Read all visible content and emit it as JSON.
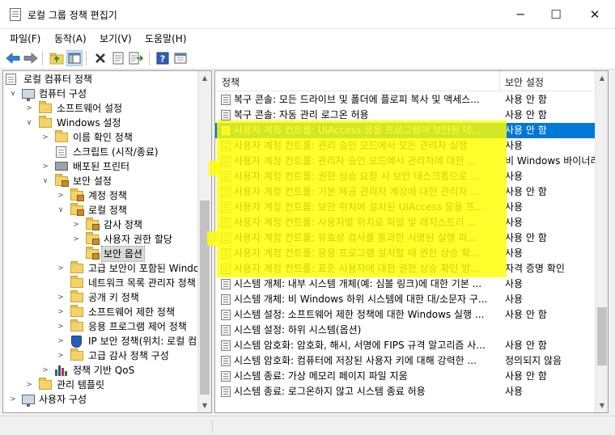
{
  "window": {
    "title": "로컬 그룹 정책 편집기",
    "min_glyph": "─",
    "max_glyph": "☐",
    "close_glyph": "✕"
  },
  "menu": [
    "파일(F)",
    "동작(A)",
    "보기(V)",
    "도움말(H)"
  ],
  "toolbar_icons": [
    "back-icon",
    "forward-icon",
    "up-folder-icon",
    "show-hide-tree-icon",
    "delete-icon",
    "properties-icon",
    "export-list-icon",
    "help-icon",
    "console-icon"
  ],
  "tree": {
    "root": "로컬 컴퓨터 정책",
    "computer_config": "컴퓨터 구성",
    "software_settings": "소프트웨어 설정",
    "windows_settings": "Windows 설정",
    "name_resolution_policy": "이름 확인 정책",
    "scripts": "스크립트 (시작/종료)",
    "deployed_printers": "배포된 프린터",
    "security_settings": "보안 설정",
    "account_policies": "계정 정책",
    "local_policies": "로컬 정책",
    "audit_policy": "감사 정책",
    "user_rights_assignment": "사용자 권한 할당",
    "security_options": "보안 옵션",
    "advanced_firewall": "고급 보안이 포함된 Windo",
    "network_list_manager": "네트워크 목록 관리자 정책",
    "public_key_policies": "공개 키 정책",
    "software_restriction": "소프트웨어 제한 정책",
    "app_control": "응용 프로그램 제어 정책",
    "ip_security": "IP 보안 정책(위치: 로컬 컴",
    "advanced_audit": "고급 감사 정책 구성",
    "policy_qos": "정책 기반 QoS",
    "admin_templates": "관리 템플릿",
    "user_config": "사용자 구성"
  },
  "list": {
    "columns": {
      "policy": "정책",
      "setting": "보안 설정"
    },
    "selected_index": 2,
    "rows": [
      {
        "policy": "복구 콘솔: 모든 드라이브 및 폴더에 플로피 복사 및 액세스...",
        "setting": "사용 안 함"
      },
      {
        "policy": "복구 콘솔: 자동 관리 로그온 허용",
        "setting": "사용 안 함"
      },
      {
        "policy": "사용자 계정 컨트롤: UIAccess 응용 프로그램이 보안된 데...",
        "setting": "사용 안 함"
      },
      {
        "policy": "사용자 계정 컨트롤: 관리 승인 모드에서 모든 관리자 실행",
        "setting": "사용"
      },
      {
        "policy": "사용자 계정 컨트롤: 관리자 승인 모드에서 관리자에 대한 ...",
        "setting": "비 Windows 바이너리"
      },
      {
        "policy": "사용자 계정 컨트롤: 권한 상승 요청 시 보안 데스크톱으로 ...",
        "setting": "사용"
      },
      {
        "policy": "사용자 계정 컨트롤: 기본 제공 관리자 계정에 대한 관리자 ...",
        "setting": "사용 안 함"
      },
      {
        "policy": "사용자 계정 컨트롤: 보안 위치에 설치된 UIAccess 응용 프...",
        "setting": "사용"
      },
      {
        "policy": "사용자 계정 컨트롤: 사용자별 위치로 파일 및 레지스트리 ...",
        "setting": "사용"
      },
      {
        "policy": "사용자 계정 컨트롤: 유효성 검사를 통과한 서명된 실행 파...",
        "setting": "사용 안 함"
      },
      {
        "policy": "사용자 계정 컨트롤: 응용 프로그램 설치할 때 권한 상승 확...",
        "setting": "사용"
      },
      {
        "policy": "사용자 계정 컨트롤: 표준 사용자에 대한 권한 상승 확인 방...",
        "setting": "자격 증명 확인"
      },
      {
        "policy": "시스템 개체: 내부 시스템 개체(예: 심볼 링크)에 대한 기본 ...",
        "setting": "사용"
      },
      {
        "policy": "시스템 개체: 비 Windows 하위 시스템에 대한 대/소문자 구...",
        "setting": "사용"
      },
      {
        "policy": "시스템 설정: 소프트웨어 제한 정책에 대한 Windows 실행 ...",
        "setting": "사용 안 함"
      },
      {
        "policy": "시스템 설정: 하위 시스템(옵션)",
        "setting": ""
      },
      {
        "policy": "시스템 암호화: 암호화, 해시, 서명에 FIPS 규격 알고리즘 사...",
        "setting": "사용 안 함"
      },
      {
        "policy": "시스템 암호화: 컴퓨터에 저장된 사용자 키에 대해 강력한 ...",
        "setting": "정의되지 않음"
      },
      {
        "policy": "시스템 종료: 가상 메모리 페이지 파일 지움",
        "setting": "사용 안 함"
      },
      {
        "policy": "시스템 종료: 로그온하지 않고 시스템 종료 허용",
        "setting": "사용"
      }
    ]
  },
  "colors": {
    "selection": "#0078d7",
    "highlight_marker": "#ffff00",
    "folder": "#f4d36b"
  }
}
